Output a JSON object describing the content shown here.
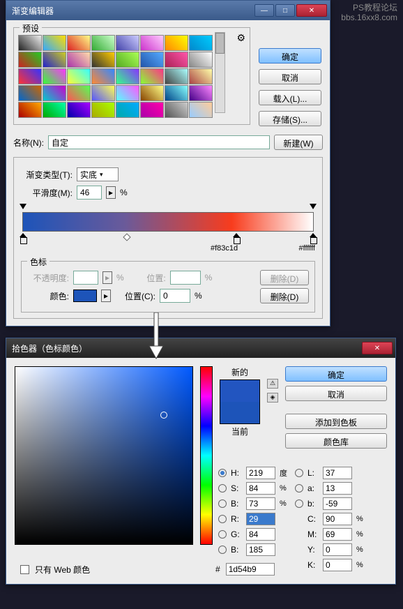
{
  "watermark": {
    "l1": "PS教程论坛",
    "l2": "bbs.16xx8.com"
  },
  "gradient_editor": {
    "title": "渐变编辑器",
    "presets_label": "预设",
    "buttons": {
      "ok": "确定",
      "cancel": "取消",
      "load": "载入(L)...",
      "save": "存储(S)..."
    },
    "name_label": "名称(N):",
    "name_value": "自定",
    "new_btn": "新建(W)",
    "type_label": "渐变类型(T):",
    "type_value": "实底",
    "smooth_label": "平滑度(M):",
    "smooth_value": "46",
    "percent": "%",
    "color_stops": {
      "hex1": "#f83c1d",
      "hex2": "#ffffff"
    },
    "stops_label": "色标",
    "opacity_label": "不透明度:",
    "position_label": "位置:",
    "delete_d": "删除(D)",
    "color_label": "颜色:",
    "location_label": "位置(C):",
    "location_value": "0",
    "swatch_color": "#1d54b9"
  },
  "color_picker": {
    "title": "拾色器（色标颜色）",
    "new_label": "新的",
    "current_label": "当前",
    "new_color": "#2255c0",
    "cur_color": "#1d54b9",
    "buttons": {
      "ok": "确定",
      "cancel": "取消",
      "add": "添加到色板",
      "lib": "颜色库"
    },
    "H": {
      "lbl": "H:",
      "val": "219",
      "unit": "度"
    },
    "S": {
      "lbl": "S:",
      "val": "84",
      "unit": "%"
    },
    "Bv": {
      "lbl": "B:",
      "val": "73",
      "unit": "%"
    },
    "L": {
      "lbl": "L:",
      "val": "37"
    },
    "a": {
      "lbl": "a:",
      "val": "13"
    },
    "b": {
      "lbl": "b:",
      "val": "-59"
    },
    "R": {
      "lbl": "R:",
      "val": "29"
    },
    "G": {
      "lbl": "G:",
      "val": "84"
    },
    "Bb": {
      "lbl": "B:",
      "val": "185"
    },
    "C": {
      "lbl": "C:",
      "val": "90",
      "unit": "%"
    },
    "M": {
      "lbl": "M:",
      "val": "69",
      "unit": "%"
    },
    "Y": {
      "lbl": "Y:",
      "val": "0",
      "unit": "%"
    },
    "K": {
      "lbl": "K:",
      "val": "0",
      "unit": "%"
    },
    "hex_prefix": "#",
    "hex": "1d54b9",
    "web_only": "只有 Web 颜色",
    "sv_cursor": {
      "left_pct": 84,
      "top_pct": 27
    }
  },
  "preset_colors": [
    "linear-gradient(45deg,#222,#eee)",
    "linear-gradient(45deg,#3af,#fd0)",
    "linear-gradient(45deg,#d22,#ff8)",
    "linear-gradient(45deg,#3a3,#cfc)",
    "linear-gradient(45deg,#44a,#ccf)",
    "linear-gradient(45deg,#c3c,#fcf)",
    "linear-gradient(45deg,#f80,#ff0)",
    "linear-gradient(45deg,#08c,#0cf)",
    "linear-gradient(45deg,#c22,#2c2)",
    "linear-gradient(45deg,#22c,#cc2)",
    "linear-gradient(45deg,#a3a,#fda)",
    "linear-gradient(45deg,#333,#fc0)",
    "linear-gradient(45deg,#5a2,#af5)",
    "linear-gradient(45deg,#25a,#5af)",
    "linear-gradient(45deg,#a25,#f5a)",
    "linear-gradient(45deg,#888,#fff)",
    "linear-gradient(45deg,#f33,#33f)",
    "linear-gradient(45deg,#3f3,#f3f)",
    "linear-gradient(45deg,#ff3,#3ff)",
    "linear-gradient(45deg,#f83,#38f)",
    "linear-gradient(45deg,#3f8,#83f)",
    "linear-gradient(45deg,#8f3,#f38)",
    "linear-gradient(45deg,#444,#aff)",
    "linear-gradient(45deg,#a44,#ffa)",
    "linear-gradient(45deg,#06c,#c60)",
    "linear-gradient(45deg,#0cc,#c0c)",
    "linear-gradient(45deg,#f55,#5f5)",
    "linear-gradient(45deg,#55f,#ff5)",
    "linear-gradient(45deg,#5ff,#f5f)",
    "linear-gradient(45deg,#840,#ff8)",
    "linear-gradient(45deg,#048,#8ff)",
    "linear-gradient(45deg,#408,#f8f)",
    "linear-gradient(45deg,#a00,#fa0)",
    "linear-gradient(45deg,#0a0,#0fa)",
    "linear-gradient(45deg,#00a,#a0f)",
    "linear-gradient(45deg,#aa0,#af0)",
    "linear-gradient(45deg,#0aa,#0af)",
    "linear-gradient(45deg,#a0a,#f0a)",
    "linear-gradient(45deg,#555,#ccc)",
    "linear-gradient(45deg,#9cf,#fc9)"
  ]
}
